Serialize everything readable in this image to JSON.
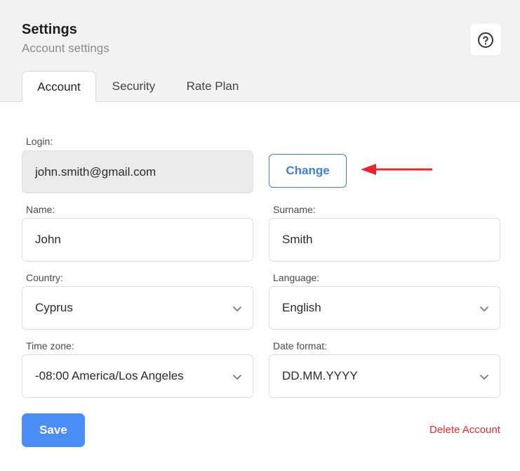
{
  "header": {
    "title": "Settings",
    "subtitle": "Account settings",
    "help_icon": "question-circle-icon"
  },
  "tabs": [
    {
      "label": "Account",
      "active": true
    },
    {
      "label": "Security",
      "active": false
    },
    {
      "label": "Rate Plan",
      "active": false
    }
  ],
  "form": {
    "login": {
      "label": "Login:",
      "value": "john.smith@gmail.com"
    },
    "change_label": "Change",
    "name": {
      "label": "Name:",
      "value": "John"
    },
    "surname": {
      "label": "Surname:",
      "value": "Smith"
    },
    "country": {
      "label": "Country:",
      "value": "Cyprus"
    },
    "language": {
      "label": "Language:",
      "value": "English"
    },
    "timezone": {
      "label": "Time zone:",
      "value": "-08:00 America/Los Angeles"
    },
    "date_format": {
      "label": "Date format:",
      "value": "DD.MM.YYYY"
    },
    "save_label": "Save",
    "delete_label": "Delete Account"
  },
  "colors": {
    "accent": "#4a8df5",
    "link_blue": "#3d7fe0",
    "danger": "#e02f2f",
    "annotation_arrow": "#e8242f"
  }
}
